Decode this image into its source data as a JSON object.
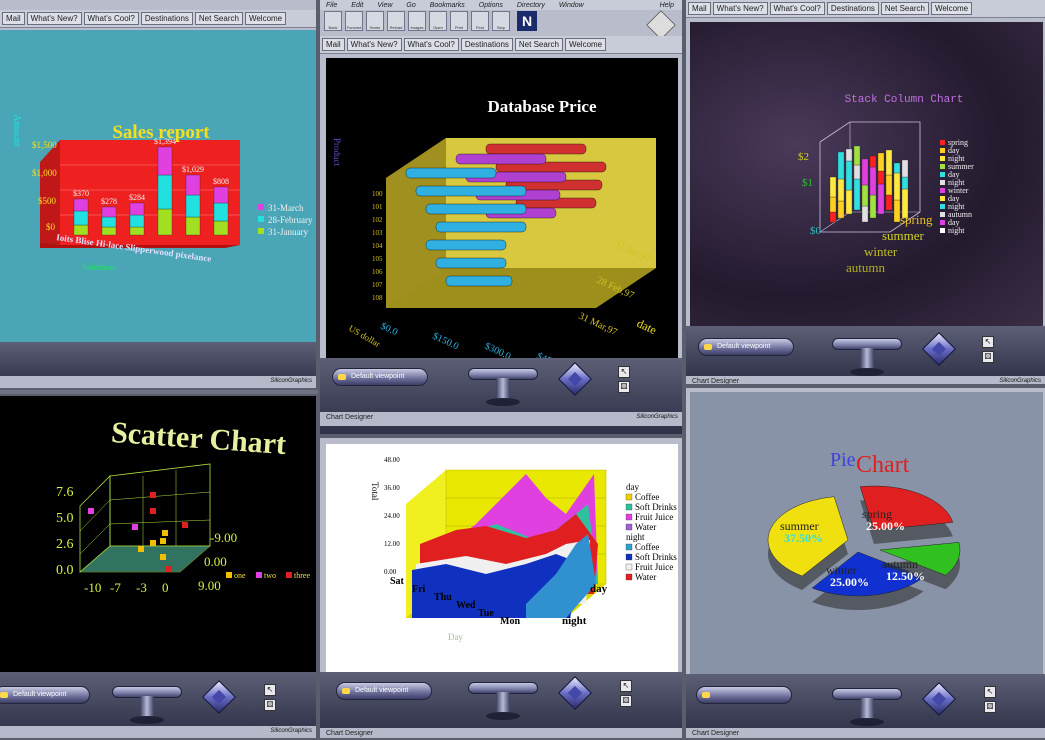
{
  "nav_buttons": [
    "Mail",
    "What's New?",
    "What's Cool?",
    "Destinations",
    "Net Search",
    "Welcome"
  ],
  "menu": [
    "File",
    "Edit",
    "View",
    "Go",
    "Bookmarks",
    "Options",
    "Directory",
    "Window",
    "Help"
  ],
  "toolbar": [
    "Back",
    "Forward",
    "Home",
    "Reload",
    "Images",
    "Open",
    "Print",
    "Find",
    "Stop"
  ],
  "viewer": {
    "viewpoint_label": "Default viewpoint",
    "pointer_icon": "arrow-cursor-icon"
  },
  "status": {
    "label": "Chart Designer",
    "logo": "SiliconGraphics"
  },
  "windows": {
    "sales": {
      "chart_data": {
        "type": "bar",
        "title": "Sales report",
        "ylabel": "Amount",
        "yticks": [
          "$0",
          "$500",
          "$1,000",
          "$1,500"
        ],
        "categories": [
          "Ioits",
          "Blisters",
          "Hi-lace",
          "Slipperwood",
          "Pixel",
          "Fordeance"
        ],
        "category_labels_visible": "Ioits Blise Hi-lace Slipperwood pixelance",
        "value_labels": [
          "$370",
          "$278",
          "$284",
          "$1,394",
          "$1,029",
          "$808"
        ],
        "legend": [
          "31-March",
          "28-February",
          "31-January"
        ],
        "series_colors": [
          "#e040e0",
          "#20e0e0",
          "#a0e020"
        ],
        "xlabel": "Salesman"
      }
    },
    "database": {
      "chart_data": {
        "type": "bar",
        "title": "Database Price",
        "ylabel": "Product",
        "xticks": [
          "$0.0",
          "$150.0",
          "$300.0",
          "$450.0"
        ],
        "xlabel": "US dollar",
        "yticks": [
          "100",
          "101",
          "102",
          "103",
          "104",
          "105",
          "106",
          "107",
          "108"
        ],
        "dates": [
          "31 Jan,97",
          "28 Feb,97",
          "31 Mar,97"
        ],
        "zlabel": "date",
        "series_colors": [
          "#30b0e0",
          "#b040d0",
          "#d03030"
        ]
      }
    },
    "stack": {
      "chart_data": {
        "type": "bar",
        "title": "Stack Column Chart",
        "yticks": [
          "$0",
          "$1",
          "$2"
        ],
        "seasons": [
          "spring",
          "summer",
          "winter",
          "autumn"
        ],
        "legend": [
          "spring",
          "day",
          "night",
          "summer",
          "day",
          "night",
          "winter",
          "day",
          "night",
          "autumn",
          "day",
          "night"
        ]
      }
    },
    "scatter": {
      "chart_data": {
        "type": "scatter",
        "title": "Scatter Chart",
        "yticks": [
          "0.0",
          "2.6",
          "5.0",
          "7.6"
        ],
        "xticks": [
          "-10",
          "-7",
          "-3",
          "0"
        ],
        "zticks": [
          "-9.00",
          "0.00",
          "9.00"
        ],
        "legend": [
          "one",
          "two",
          "three"
        ],
        "series_colors": [
          "#f0c000",
          "#e040e0",
          "#e02020"
        ]
      }
    },
    "area": {
      "chart_data": {
        "type": "area",
        "ylabel": "Total",
        "yticks": [
          "0.00",
          "12.00",
          "24.00",
          "36.00",
          "48.00"
        ],
        "categories": [
          "Sat",
          "Fri",
          "Thu",
          "Wed",
          "Tue",
          "Mon"
        ],
        "xlabel": "Day",
        "depth_labels": [
          "day",
          "night"
        ],
        "legend_groups": [
          {
            "name": "day",
            "items": [
              "Coffee",
              "Soft Drinks",
              "Fruit Juice",
              "Water"
            ]
          },
          {
            "name": "night",
            "items": [
              "Coffee",
              "Soft Drinks",
              "Fruit Juice",
              "Water"
            ]
          }
        ],
        "legend_colors": [
          "#f0d000",
          "#30c0a0",
          "#e040e0",
          "#a060d0",
          "#30a0d0",
          "#1030c0",
          "#f0f0f0",
          "#e02020"
        ]
      }
    },
    "pie": {
      "chart_data": {
        "type": "pie",
        "title_part1": "Pie",
        "title_part2": "Chart",
        "slices": [
          {
            "name": "spring",
            "value": 25.0,
            "label": "25.00%"
          },
          {
            "name": "summer",
            "value": 37.5,
            "label": "37.50%"
          },
          {
            "name": "winter",
            "value": 25.0,
            "label": "25.00%"
          },
          {
            "name": "autumn",
            "value": 12.5,
            "label": "12.50%"
          }
        ],
        "series_colors": [
          "#e02020",
          "#f0e010",
          "#1030d0",
          "#30c020"
        ]
      }
    }
  }
}
